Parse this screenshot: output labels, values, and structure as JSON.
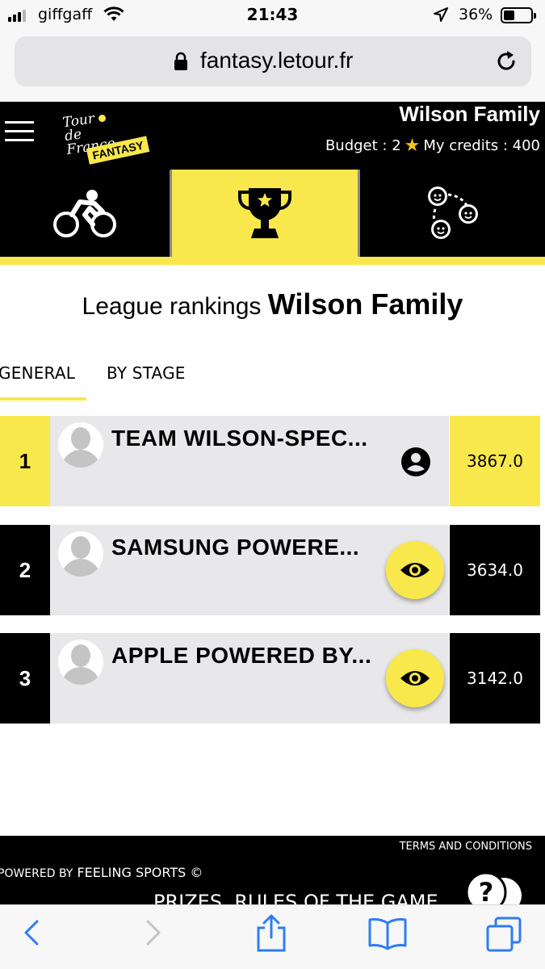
{
  "status_bar": {
    "carrier": "giffgaff",
    "time": "21:43",
    "battery_percent": "36%",
    "battery_level": 0.36
  },
  "browser": {
    "url": "fantasy.letour.fr"
  },
  "header": {
    "logo_text": "Tour de France",
    "logo_badge": "FANTASY",
    "family_name": "Wilson Family",
    "budget_label": "Budget : 2",
    "credits_label": "My credits : 400",
    "brand_color": "#f9e84b"
  },
  "nav": {
    "items": [
      {
        "name": "rider",
        "icon": "cyclist-icon",
        "active": false
      },
      {
        "name": "rankings",
        "icon": "trophy-icon",
        "active": true
      },
      {
        "name": "friends",
        "icon": "friends-icon",
        "active": false
      }
    ]
  },
  "page": {
    "title_prefix": "League rankings",
    "title_name": "Wilson Family"
  },
  "tabs": {
    "general": "GENERAL",
    "by_stage": "BY STAGE",
    "active": "general"
  },
  "rankings": [
    {
      "rank": "1",
      "team": "TEAM WILSON-SPEC...",
      "score": "3867.0",
      "action_icon": "profile-icon"
    },
    {
      "rank": "2",
      "team": "SAMSUNG POWERE...",
      "score": "3634.0",
      "action_icon": "eye-icon"
    },
    {
      "rank": "3",
      "team": "APPLE POWERED BY...",
      "score": "3142.0",
      "action_icon": "eye-icon"
    }
  ],
  "footer": {
    "terms": "TERMS AND CONDITIONS",
    "powered_prefix": "POWERED BY",
    "powered_name": "FEELING SPORTS ©",
    "prizes": "PRIZES, RULES OF THE GAME"
  }
}
